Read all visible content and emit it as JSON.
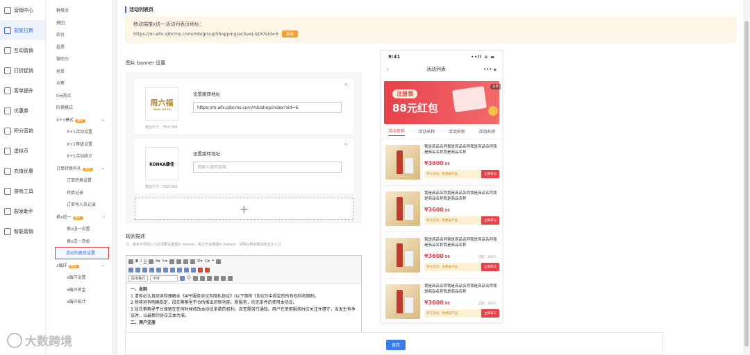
{
  "sidebar": {
    "items": [
      {
        "label": "营销中心",
        "icon": "megaphone-icon"
      },
      {
        "label": "裂变拉新",
        "icon": "fission-icon",
        "active": true
      },
      {
        "label": "互动营销",
        "icon": "interaction-icon"
      },
      {
        "label": "打折促销",
        "icon": "discount-icon"
      },
      {
        "label": "客单提升",
        "icon": "order-icon"
      },
      {
        "label": "优惠券",
        "icon": "coupon-icon"
      },
      {
        "label": "积分营销",
        "icon": "points-icon"
      },
      {
        "label": "虚拟币",
        "icon": "coin-icon"
      },
      {
        "label": "充值优惠",
        "icon": "recharge-icon"
      },
      {
        "label": "游戏工具",
        "icon": "game-icon"
      },
      {
        "label": "裂发助手",
        "icon": "assistant-icon"
      },
      {
        "label": "智能营销",
        "icon": "smart-icon"
      }
    ]
  },
  "subnav": {
    "items": [
      "群接龙",
      "拼团",
      "砍价",
      "投票",
      "微助力",
      "抢单",
      "众筹",
      "0元购买",
      "阶梯模式"
    ],
    "xplus1": {
      "label": "X+1模式",
      "badge": "推荐",
      "children": [
        "X+1活动设置",
        "X+1等级设置",
        "X+1活动统计"
      ]
    },
    "order_gift": {
      "label": "订单转换有礼",
      "badge": "推荐",
      "children": [
        "订单转换设置",
        "转换记录",
        "订单导入及记录"
      ]
    },
    "xback1": {
      "label": "换x送一",
      "badge": "推荐",
      "children": [
        "换x送一设置",
        "换x送一资金",
        "活动列表页设置"
      ]
    },
    "xloop": {
      "label": "x循环",
      "badge": "推荐",
      "children": [
        "x循环设置",
        "x循环资金",
        "x循环统计"
      ]
    }
  },
  "page": {
    "title": "活动列表页",
    "notice_line1": "移动端推x送一活动列表页地址：",
    "notice_url": "https://m.wfx.qibcms.com/mb/groupShopping/activeListX?sid=6",
    "copy_label": "复制"
  },
  "banner": {
    "title": "图片 banner 设置",
    "cards": [
      {
        "brand": "周六福",
        "brand_sub": "ZHOU LIU FU",
        "hint": "建议尺寸：750*260",
        "link_label": "设置跳转地址",
        "link_value": "https://m.wfx.qibcms.com/mb/shop/index?sid=6",
        "placeholder": ""
      },
      {
        "brand": "KONKA康佳",
        "brand_sub": "",
        "hint": "建议尺寸：750*260",
        "link_label": "设置跳转地址",
        "link_value": "",
        "placeholder": "请输入跳转链接"
      }
    ],
    "add_symbol": "+"
  },
  "rules": {
    "title": "规则描述",
    "note": "注：最多示规则入口必须要设置图片 banner，如之不设置图片 banner，规则在移动端没有显示入口",
    "toolbar": {
      "font_style": "段落格式",
      "font_family": "字体"
    },
    "content": [
      {
        "bold": true,
        "text": "一、总则"
      },
      {
        "bold": false,
        "text": "1 请务必认真阅读和理解本《APP服务协议及隐私协议》(以下简称《协议》)中规定的所有权利和限制。"
      },
      {
        "bold": false,
        "text": "2 除非另有明确规定，段氏蒂蒂里平台所推出的新功能、新服务，均无条件的使用本协议。"
      },
      {
        "bold": false,
        "text": "3 段氏蒂蒂里平台保留在任何时候修改本协议条款的权利，且无需另行通知。用户在使用服务时应关注并遵守，当发生有争议时，以最新的协议文本为准。"
      },
      {
        "bold": true,
        "text": "二、用户注册"
      }
    ]
  },
  "save_label": "保存",
  "phone": {
    "time": "9:41",
    "signal": "••ll ≋ ▬",
    "back": "‹",
    "title": "活动列表",
    "more": "•••",
    "capture": "◉",
    "hero": {
      "tag": "注册领",
      "amount": "88元红包",
      "share": "分享"
    },
    "tabs": [
      "活动名称",
      "活动名称",
      "活动名称",
      "活动名称"
    ],
    "products": [
      {
        "name": "我是商品名称我是商品名称我是商品名称我是商品名称我是商品名称",
        "price": "¥3600",
        "cents": ".99",
        "sold": "",
        "bar": "参与活动，免费拿产品",
        "btn": "立即参与"
      },
      {
        "name": "我是商品名称我是商品名称我是商品名称我是商品名称我是商品名称",
        "price": "¥3600",
        "cents": ".99",
        "sold": "",
        "bar": "参与活动，免费拿产品",
        "btn": "立即参与"
      },
      {
        "name": "我是商品名称我是商品名称我是商品名称我是商品名称我是商品名称",
        "price": "¥3600",
        "cents": ".99",
        "sold": "已售：300人",
        "bar": "参与活动，免费拿产品",
        "btn": "立即参与"
      },
      {
        "name": "我是商品名称我是商品名称我是商品名称我是商品名称我是商品名称",
        "price": "¥3600",
        "cents": ".99",
        "sold": "已售：300人",
        "bar": "参与活动，免费拿产品",
        "btn": "立即参与"
      }
    ]
  },
  "watermark": "大数跨境"
}
